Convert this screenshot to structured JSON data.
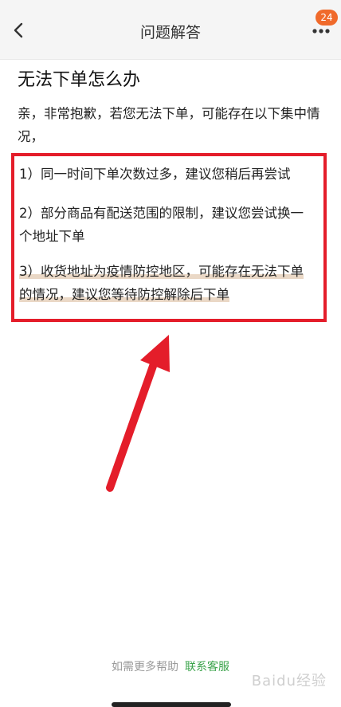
{
  "header": {
    "title": "问题解答",
    "badge_count": "24"
  },
  "question": {
    "title": "无法下单怎么办",
    "intro": "亲，非常抱歉，若您无法下单，可能存在以下集中情况，",
    "items": [
      "1）同一时间下单次数过多，建议您稍后再尝试",
      "2）部分商品有配送范围的限制，建议您尝试换一个地址下单",
      "3）收货地址为疫情防控地区，可能存在无法下单的情况，建议您等待防控解除后下单"
    ]
  },
  "footer": {
    "help_text": "如需更多帮助",
    "contact_label": "联系客服"
  },
  "watermark": "Baidu经验",
  "colors": {
    "accent_red": "#e41d2a",
    "badge": "#f06a2b",
    "link_green": "#3aa34a"
  },
  "icons": [
    "back-arrow-icon",
    "more-dots-icon"
  ]
}
